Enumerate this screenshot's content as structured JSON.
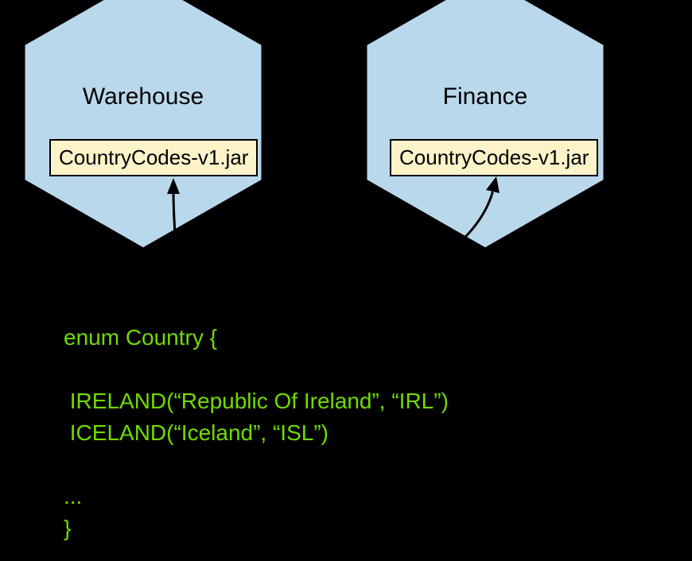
{
  "hexagons": [
    {
      "id": "warehouse",
      "label": "Warehouse",
      "jar": "CountryCodes-v1.jar"
    },
    {
      "id": "finance",
      "label": "Finance",
      "jar": "CountryCodes-v1.jar"
    }
  ],
  "code": {
    "line1": "enum Country {",
    "line2": " IRELAND(“Republic Of Ireland”, “IRL”)",
    "line3": " ICELAND(“Iceland”, “ISL”)",
    "line4": "...",
    "line5": "}"
  },
  "colors": {
    "hexFill": "#bad8ec",
    "hexStroke": "#000000",
    "jarFill": "#fdf3c9",
    "codeGreen": "#6fdc00",
    "background": "#000000"
  }
}
